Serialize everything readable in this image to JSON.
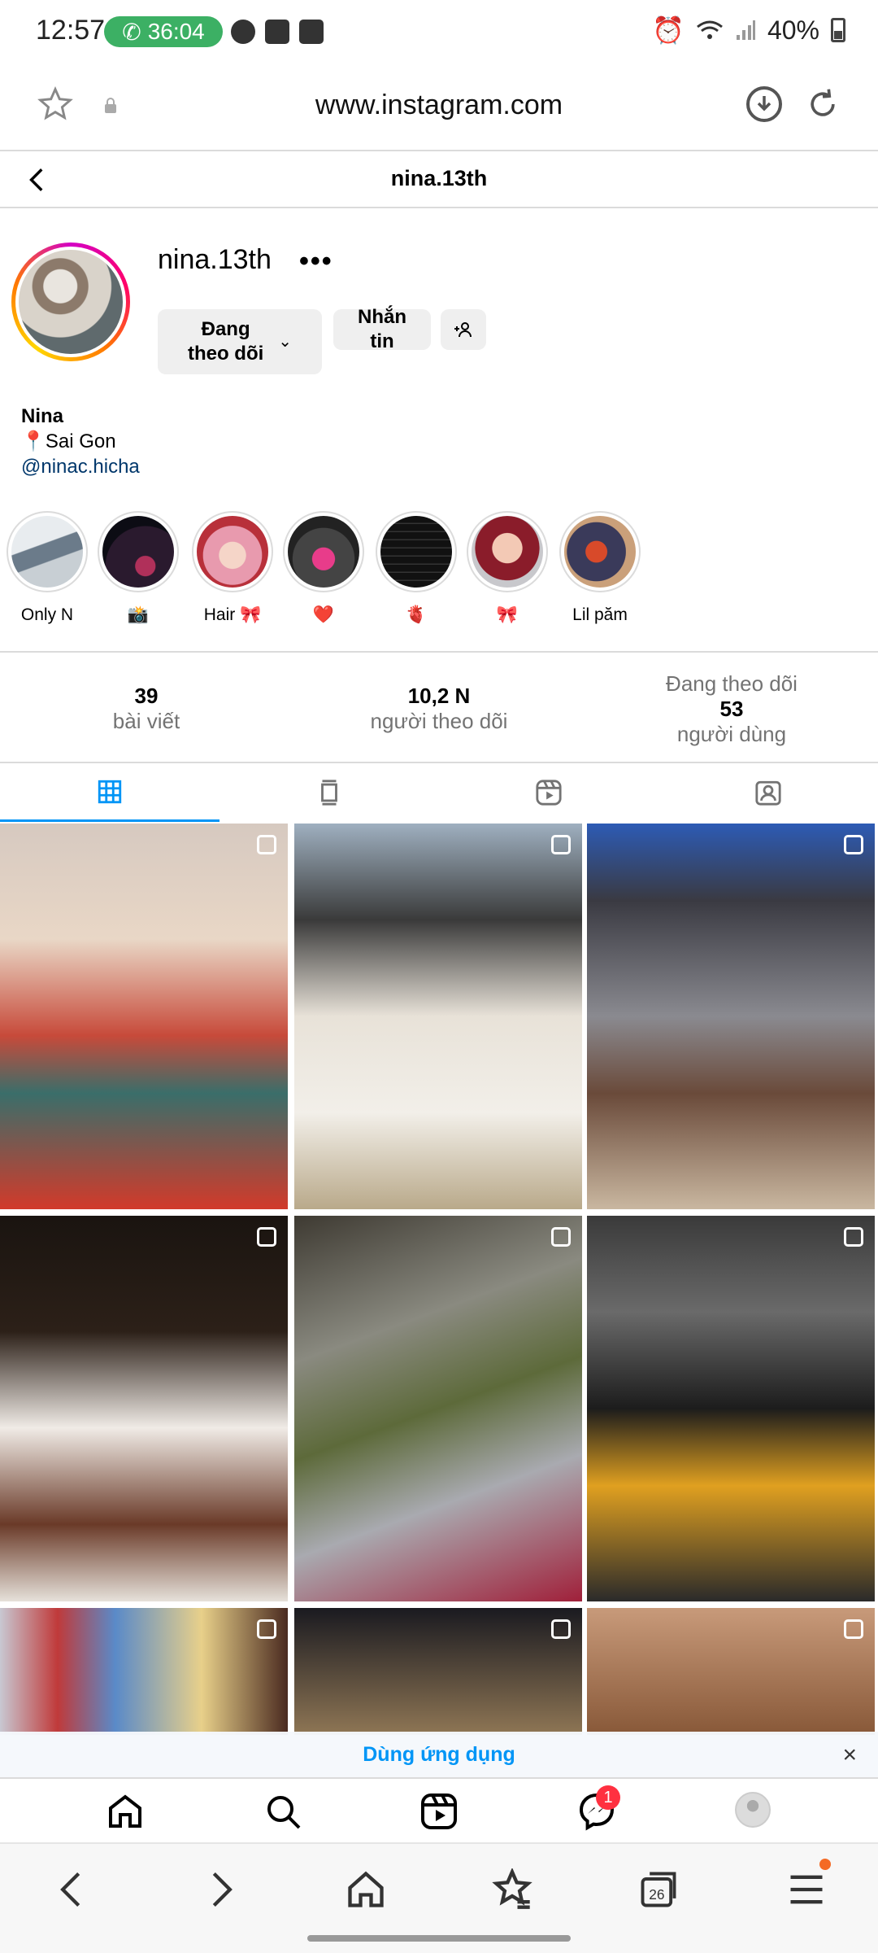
{
  "status_bar": {
    "time": "12:57",
    "call_timer": "36:04",
    "battery": "40%"
  },
  "browser": {
    "url": "www.instagram.com"
  },
  "header": {
    "title": "nina.13th"
  },
  "profile": {
    "username": "nina.13th",
    "more": "•••",
    "follow_label": "Đang\ntheo dõi",
    "message_label": "Nhắn\ntin",
    "add_label": "+&",
    "bio_name": "Nina",
    "bio_location": "Sai Gon",
    "bio_link": "@ninac.hicha"
  },
  "highlights": [
    {
      "label": "Only N"
    },
    {
      "label": "📸"
    },
    {
      "label": "Hair 🎀"
    },
    {
      "label": "❤️"
    },
    {
      "label": "🫀"
    },
    {
      "label": "🎀"
    },
    {
      "label": "Lil păm"
    }
  ],
  "stats": {
    "posts": {
      "num": "39",
      "label": "bài viết"
    },
    "followers": {
      "num": "10,2 N",
      "label": "người theo dõi"
    },
    "following": {
      "pre": "Đang theo dõi",
      "num": "53",
      "label": "người dùng"
    }
  },
  "banner": {
    "text": "Dùng ứng dụng",
    "close": "×"
  },
  "nav": {
    "messages_badge": "1"
  },
  "colors": {
    "accent": "#0095f6",
    "badge": "#ff3040",
    "call": "#3cb064"
  }
}
